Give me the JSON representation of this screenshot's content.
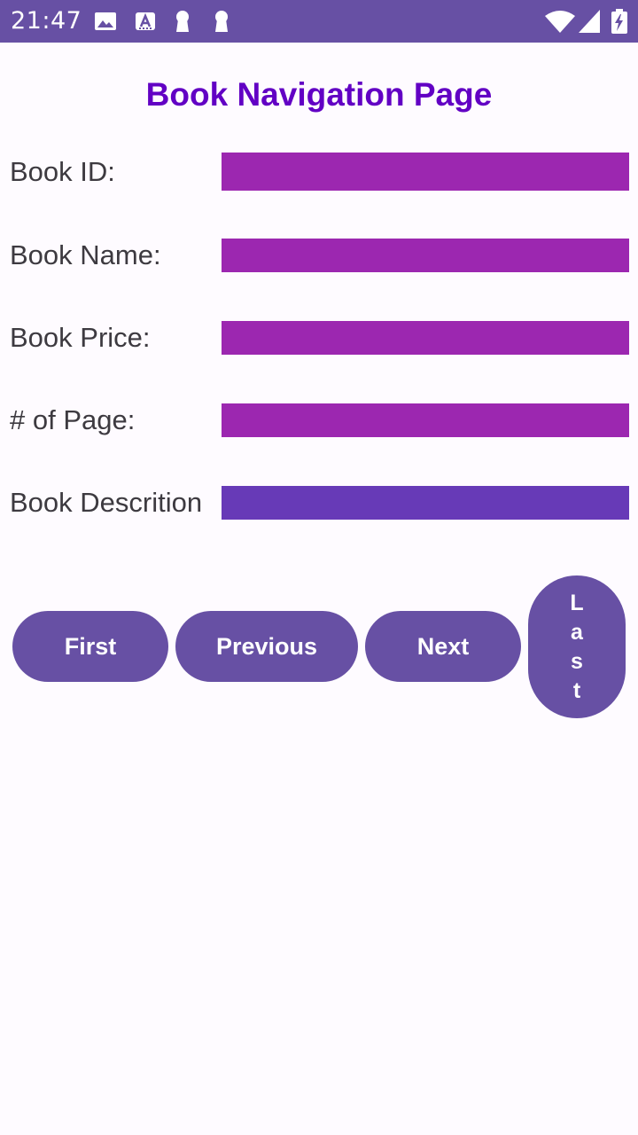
{
  "status_bar": {
    "time": "21:47",
    "left_icons": [
      "image-icon",
      "text-format-icon",
      "keyhole-icon",
      "keyhole-icon"
    ],
    "right_icons": [
      "wifi-icon",
      "cell-signal-icon",
      "battery-charging-icon"
    ],
    "background": "#6750a4"
  },
  "page": {
    "title": "Book Navigation Page",
    "title_color": "#6200c4",
    "background": "#fefbff"
  },
  "form": {
    "fields": [
      {
        "label": "Book ID:",
        "value": ""
      },
      {
        "label": "Book Name:",
        "value": ""
      },
      {
        "label": "Book Price:",
        "value": ""
      },
      {
        "label": "# of Page:",
        "value": ""
      },
      {
        "label": "Book Descrition",
        "value": ""
      }
    ],
    "field_color": "#9c27b0",
    "description_field_color": "#673ab7"
  },
  "navigation": {
    "first_label": "First",
    "previous_label": "Previous",
    "next_label": "Next",
    "last_label": "Last",
    "button_color": "#6750a4"
  }
}
